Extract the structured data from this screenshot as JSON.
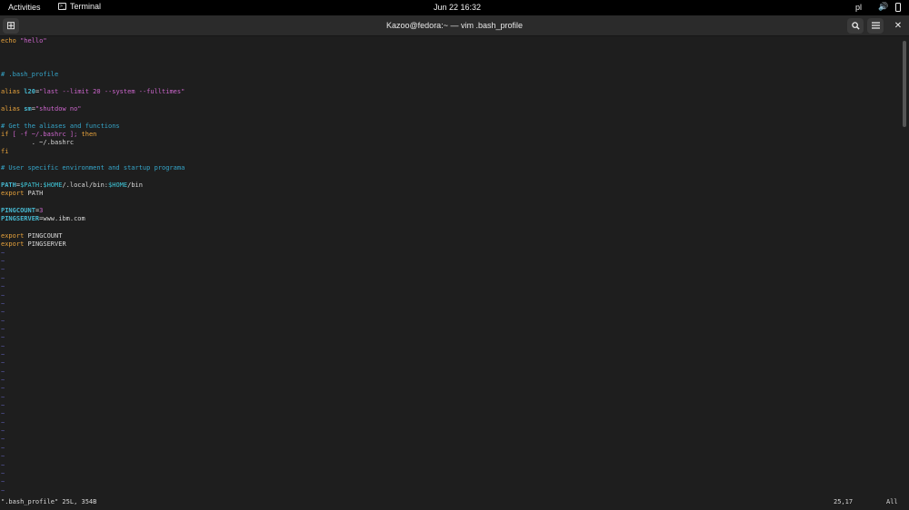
{
  "topbar": {
    "activities": "Activities",
    "app_name": "Terminal",
    "app_icon_glyph": ">_",
    "clock": "Jun 22  16:32",
    "keyboard_layout": "pl",
    "volume_glyph": "🔊"
  },
  "window": {
    "title": "Kazoo@fedora:~ — vim .bash_profile",
    "new_tab_glyph": "⊞",
    "search_glyph": "🔍",
    "menu_glyph": "☰",
    "close_glyph": "✕"
  },
  "colors": {
    "keyword": "#e8a33c",
    "string": "#cc66cc",
    "comment": "#35a5c9",
    "variable": "#3fc6d8",
    "ident_bold": "#47b8d0",
    "tilde": "#5a5aa8",
    "text": "#d8d8d8"
  },
  "buffer": {
    "lines": [
      [
        {
          "t": "echo ",
          "c": "keyword"
        },
        {
          "t": "\"hello\"",
          "c": "string"
        }
      ],
      [],
      [],
      [],
      [
        {
          "t": "# .bash_profile",
          "c": "comment"
        }
      ],
      [],
      [
        {
          "t": "alias ",
          "c": "keyword"
        },
        {
          "t": "l20",
          "c": "ident_bold"
        },
        {
          "t": "=",
          "c": "text"
        },
        {
          "t": "\"last --limit 20 --system --fulltimes\"",
          "c": "string"
        }
      ],
      [],
      [
        {
          "t": "alias ",
          "c": "keyword"
        },
        {
          "t": "sm",
          "c": "ident_bold"
        },
        {
          "t": "=",
          "c": "text"
        },
        {
          "t": "\"shutdow no\"",
          "c": "string"
        }
      ],
      [],
      [
        {
          "t": "# Get the aliases and functions",
          "c": "comment"
        }
      ],
      [
        {
          "t": "if",
          "c": "keyword"
        },
        {
          "t": " [ -f ~/.bashrc ]; ",
          "c": "string"
        },
        {
          "t": "then",
          "c": "keyword"
        }
      ],
      [
        {
          "t": "        . ~/.bashrc",
          "c": "text"
        }
      ],
      [
        {
          "t": "fi",
          "c": "keyword"
        }
      ],
      [],
      [
        {
          "t": "# User specific environment and startup programa",
          "c": "comment"
        }
      ],
      [],
      [
        {
          "t": "PATH",
          "c": "ident_bold"
        },
        {
          "t": "=",
          "c": "text"
        },
        {
          "t": "$PATH",
          "c": "variable"
        },
        {
          "t": ":",
          "c": "text"
        },
        {
          "t": "$HOME",
          "c": "variable"
        },
        {
          "t": "/.local/bin:",
          "c": "text"
        },
        {
          "t": "$HOME",
          "c": "variable"
        },
        {
          "t": "/bin",
          "c": "text"
        }
      ],
      [
        {
          "t": "export ",
          "c": "keyword"
        },
        {
          "t": "PATH",
          "c": "text"
        }
      ],
      [],
      [
        {
          "t": "PINGCOUNT",
          "c": "ident_bold"
        },
        {
          "t": "=",
          "c": "text"
        },
        {
          "t": "3",
          "c": "string"
        }
      ],
      [
        {
          "t": "PINGSERVER",
          "c": "ident_bold"
        },
        {
          "t": "=www.ibm.com",
          "c": "text"
        }
      ],
      [],
      [
        {
          "t": "export ",
          "c": "keyword"
        },
        {
          "t": "PINGCOUNT",
          "c": "text"
        }
      ],
      [
        {
          "t": "export ",
          "c": "keyword"
        },
        {
          "t": "PINGSERVER",
          "c": "text"
        }
      ]
    ],
    "tilde_glyph": "~",
    "tilde_count": 29
  },
  "status": {
    "file_info": "\".bash_profile\" 25L, 354B",
    "cursor_pos": "25,17",
    "scroll_pct": "All"
  }
}
